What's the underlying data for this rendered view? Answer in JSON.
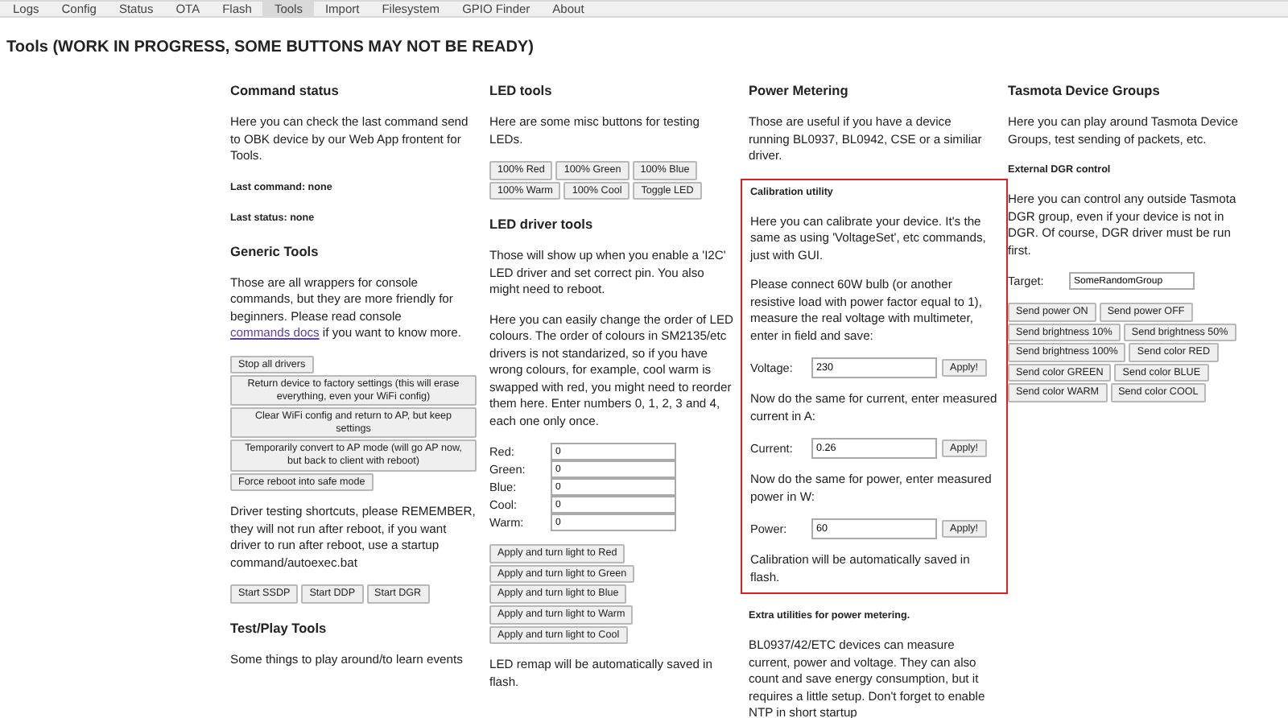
{
  "tabs": [
    {
      "label": "Logs",
      "selected": false
    },
    {
      "label": "Config",
      "selected": false
    },
    {
      "label": "Status",
      "selected": false
    },
    {
      "label": "OTA",
      "selected": false
    },
    {
      "label": "Flash",
      "selected": false
    },
    {
      "label": "Tools",
      "selected": true
    },
    {
      "label": "Import",
      "selected": false
    },
    {
      "label": "Filesystem",
      "selected": false
    },
    {
      "label": "GPIO Finder",
      "selected": false
    },
    {
      "label": "About",
      "selected": false
    }
  ],
  "page_title": "Tools (WORK IN PROGRESS, SOME BUTTONS MAY NOT BE READY)",
  "columns": [
    {
      "blocks": [
        {
          "kind": "heading",
          "text": "Command status"
        },
        {
          "kind": "paragraph",
          "text": "Here you can check the last command send to OBK device by our Web App frontent for Tools."
        },
        {
          "kind": "subheading",
          "text": "Last command: none"
        },
        {
          "kind": "subheading",
          "text": "Last status: none"
        },
        {
          "kind": "heading",
          "text": "Generic Tools"
        },
        {
          "kind": "paragraph",
          "text": "Those are all wrappers for console commands, but they are more friendly for beginners. Please read console",
          "link": "commands docs",
          "after": " if you want to know more."
        },
        {
          "kind": "buttons",
          "buttons": [
            "Stop all drivers",
            "Return device to factory settings (this will erase everything, even your WiFi config)",
            "Clear WiFi config and return to AP, but keep settings",
            "Temporarily convert to AP mode (will go AP now, but back to client with reboot)",
            "Force reboot into safe mode"
          ]
        },
        {
          "kind": "paragraph",
          "text": "Driver testing shortcuts, please REMEMBER, they will not run after reboot, if you want driver to run after reboot, use a startup command/autoexec.bat"
        },
        {
          "kind": "buttons",
          "buttons": [
            "Start SSDP",
            "Start DDP",
            "Start DGR"
          ]
        },
        {
          "kind": "heading",
          "text": "Test/Play Tools"
        },
        {
          "kind": "paragraph",
          "text": "Some things to play around/to learn events"
        }
      ]
    },
    {
      "blocks": [
        {
          "kind": "heading",
          "text": "LED tools"
        },
        {
          "kind": "paragraph",
          "text": "Here are some misc buttons for testing LEDs."
        },
        {
          "kind": "buttons",
          "buttons": [
            "100% Red",
            "100% Green",
            "100% Blue",
            "100% Warm",
            "100% Cool",
            "Toggle LED"
          ]
        },
        {
          "kind": "heading",
          "text": "LED driver tools"
        },
        {
          "kind": "paragraph",
          "text": "Those will show up when you enable a 'I2C' LED driver and set correct pin. You also might need to reboot."
        },
        {
          "kind": "paragraph",
          "text": "Here you can easily change the order of LED colours. The order of colours in SM2135/etc drivers is not standarized, so if you have wrong colours, for example, cool warm is swapped with red, you might need to reorder them here. Enter numbers 0, 1, 2, 3 and 4, each one only once."
        },
        {
          "kind": "fields",
          "fields": [
            {
              "label": "Red:",
              "value": "0"
            },
            {
              "label": "Green:",
              "value": "0"
            },
            {
              "label": "Blue:",
              "value": "0"
            },
            {
              "label": "Cool:",
              "value": "0"
            },
            {
              "label": "Warm:",
              "value": "0"
            }
          ]
        },
        {
          "kind": "buttons",
          "buttons": [
            "Apply and turn light to Red",
            "Apply and turn light to Green",
            "Apply and turn light to Blue",
            "Apply and turn light to Warm",
            "Apply and turn light to Cool"
          ]
        },
        {
          "kind": "paragraph",
          "text": "LED remap will be automatically saved in flash."
        }
      ]
    },
    {
      "blocks": [
        {
          "kind": "heading",
          "text": "Power Metering"
        },
        {
          "kind": "paragraph",
          "text": "Those are useful if you have a device running BL0937, BL0942, CSE or a similiar driver."
        },
        {
          "kind": "frame",
          "color": "#e02020",
          "blocks": [
            {
              "kind": "subheading",
              "text": "Calibration utility"
            },
            {
              "kind": "paragraph",
              "text": "Here you can calibrate your device. It's the same as using 'VoltageSet', etc commands, just with GUI."
            },
            {
              "kind": "paragraph",
              "text": "Please connect 60W bulb (or another resistive load with power factor equal to 1), measure the real voltage with multimeter, enter in field and save:"
            },
            {
              "kind": "apply_field",
              "label": "Voltage:",
              "value": "230",
              "button": "Apply!"
            },
            {
              "kind": "paragraph",
              "text": "Now do the same for current, enter measured current in A:"
            },
            {
              "kind": "apply_field",
              "label": "Current:",
              "value": "0.26",
              "button": "Apply!"
            },
            {
              "kind": "paragraph",
              "text": "Now do the same for power, enter measured power in W:"
            },
            {
              "kind": "apply_field",
              "label": "Power:",
              "value": "60",
              "button": "Apply!"
            },
            {
              "kind": "paragraph",
              "text": "Calibration will be automatically saved in flash."
            }
          ]
        },
        {
          "kind": "subheading",
          "text": "Extra utilities for power metering."
        },
        {
          "kind": "paragraph",
          "text": "BL0937/42/ETC devices can measure current, power and voltage. They can also count and save energy consumption, but it requires a little setup. Don't forget to enable NTP in short startup"
        }
      ]
    },
    {
      "blocks": [
        {
          "kind": "heading",
          "text": "Tasmota Device Groups"
        },
        {
          "kind": "paragraph",
          "text": "Here you can play around Tasmota Device Groups, test sending of packets, etc."
        },
        {
          "kind": "subheading",
          "text": "External DGR control"
        },
        {
          "kind": "paragraph",
          "text": "Here you can control any outside Tasmota DGR group, even if your device is not in DGR. Of course, DGR driver must be run first."
        },
        {
          "kind": "fields",
          "fields": [
            {
              "label": "Target:",
              "value": "SomeRandomGroup"
            }
          ]
        },
        {
          "kind": "buttons",
          "buttons": [
            "Send power ON",
            "Send power OFF",
            "Send brightness 10%",
            "Send brightness 50%",
            "Send brightness 100%",
            "Send color RED",
            "Send color GREEN",
            "Send color BLUE",
            "Send color WARM",
            "Send color COOL"
          ]
        }
      ]
    }
  ]
}
